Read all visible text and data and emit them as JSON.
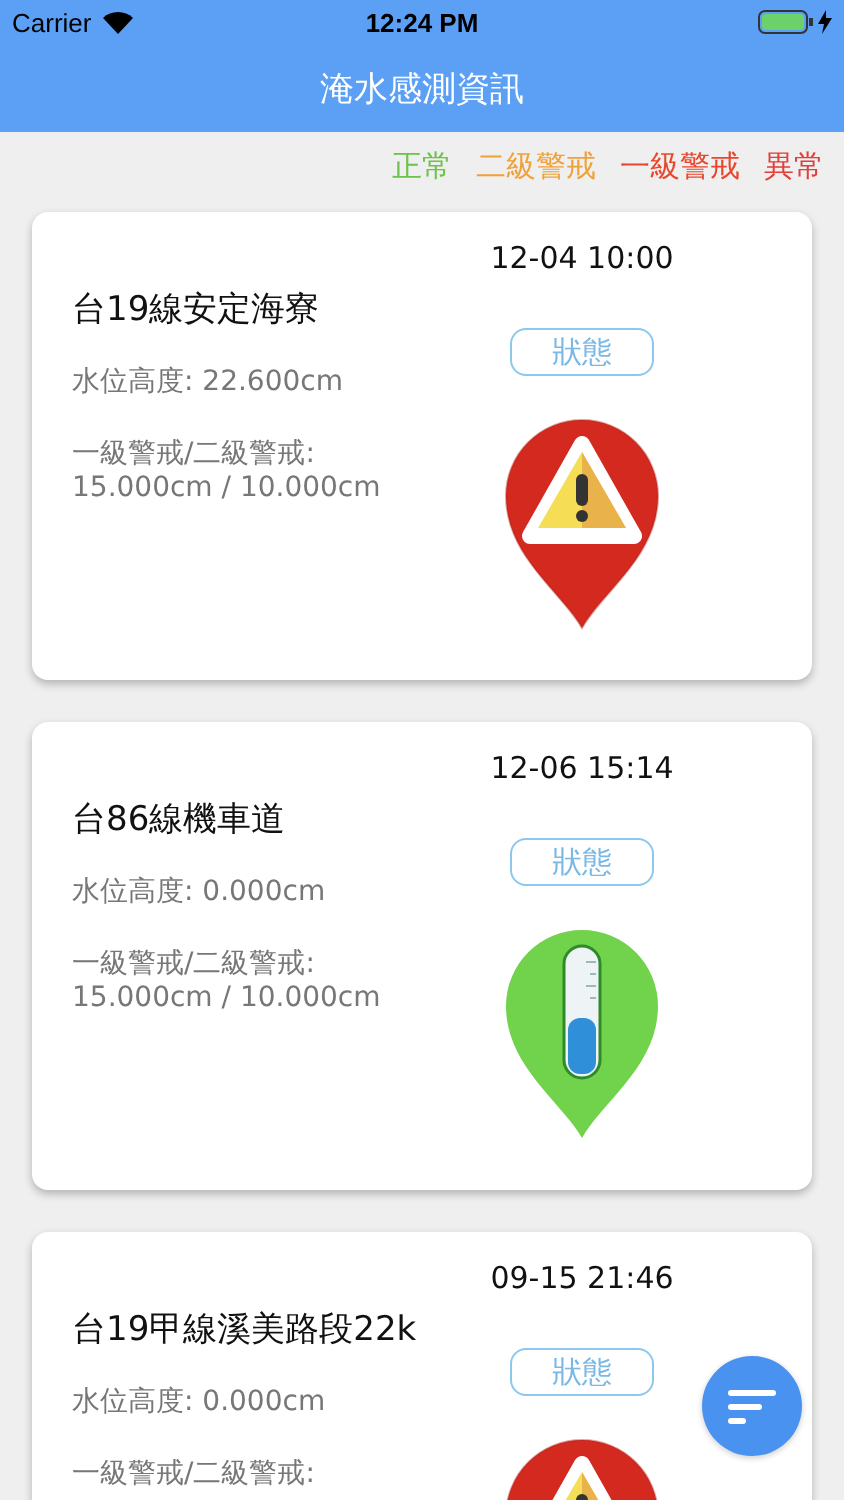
{
  "status_bar": {
    "carrier": "Carrier",
    "time": "12:24 PM"
  },
  "nav": {
    "title": "淹水感測資訊"
  },
  "legend": [
    {
      "label": "正常",
      "color": "#6cc24a"
    },
    {
      "label": "二級警戒",
      "color": "#f0a23a"
    },
    {
      "label": "一級警戒",
      "color": "#e8472e"
    },
    {
      "label": "異常",
      "color": "#e0403c"
    }
  ],
  "sensors": [
    {
      "name": "台19線安定海寮",
      "time": "12-04 10:00",
      "level_text": "水位高度: 22.600cm",
      "threshold_label": "一級警戒/二級警戒:",
      "threshold_value": "15.000cm / 10.000cm",
      "status_button": "狀態",
      "kind": "alert"
    },
    {
      "name": "台86線機車道",
      "time": "12-06 15:14",
      "level_text": "水位高度: 0.000cm",
      "threshold_label": "一級警戒/二級警戒:",
      "threshold_value": "15.000cm / 10.000cm",
      "status_button": "狀態",
      "kind": "normal"
    },
    {
      "name": "台19甲線溪美路段22k",
      "time": "09-15 21:46",
      "level_text": "水位高度: 0.000cm",
      "threshold_label": "一級警戒/二級警戒:",
      "status_button": "狀態",
      "kind": "alert"
    }
  ]
}
